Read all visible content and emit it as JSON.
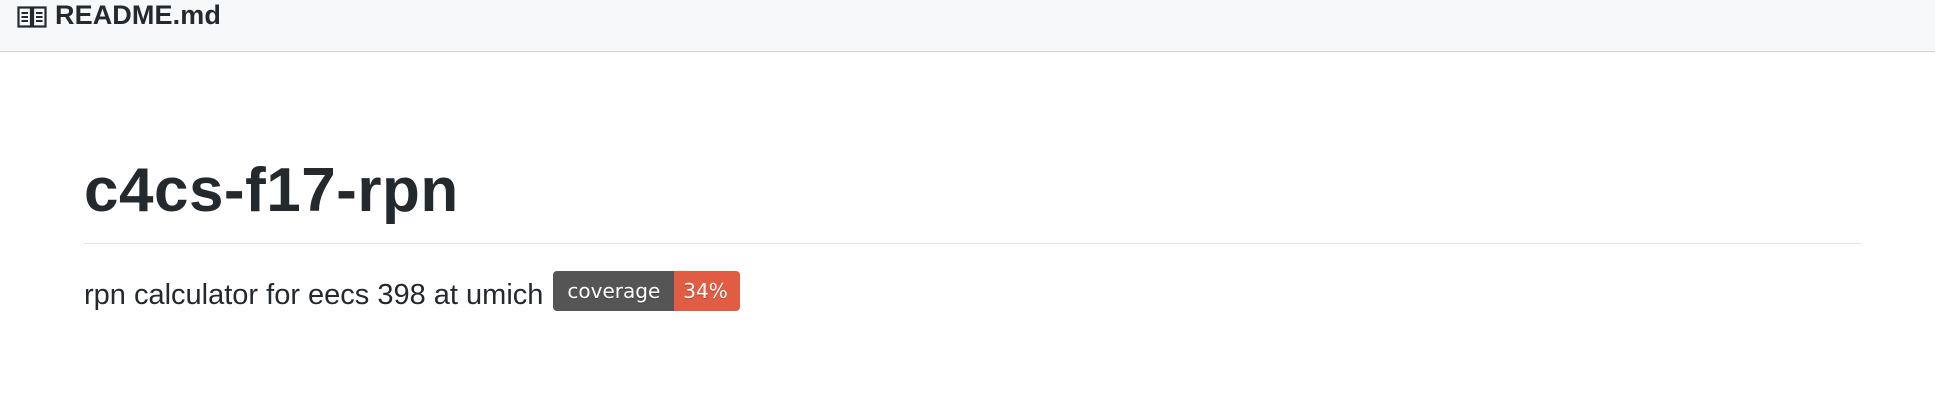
{
  "header": {
    "icon": "book-icon",
    "filename": "README.md"
  },
  "readme": {
    "title": "c4cs-f17-rpn",
    "description": "rpn calculator for eecs 398 at umich",
    "badge": {
      "label": "coverage",
      "value": "34%",
      "label_color": "#555555",
      "value_color": "#e05d44"
    }
  }
}
